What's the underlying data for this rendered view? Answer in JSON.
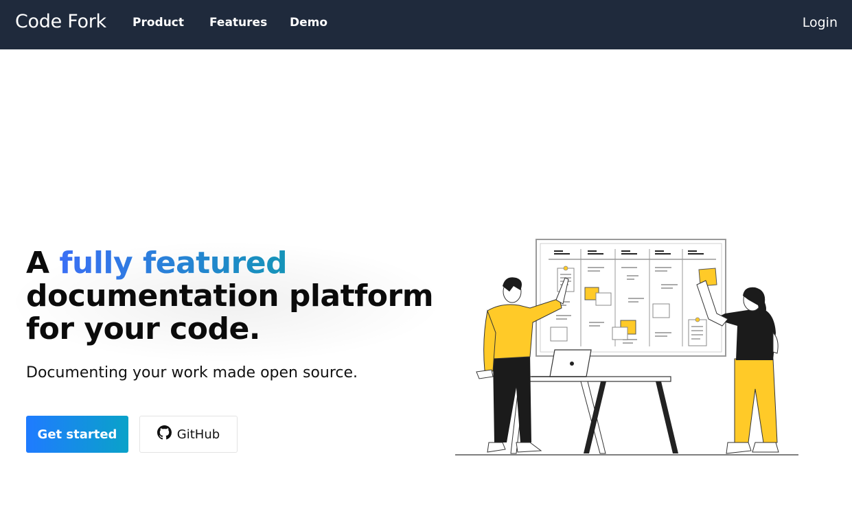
{
  "nav": {
    "brand": "Code Fork",
    "links": [
      "Product",
      "Features",
      "Demo"
    ],
    "login": "Login"
  },
  "hero": {
    "title_prefix": "A ",
    "title_accent": "fully featured",
    "title_line2": "documentation platform",
    "title_line3": "for your code.",
    "subtitle": "Documenting your work made open source."
  },
  "buttons": {
    "primary": "Get started",
    "github": "GitHub"
  },
  "colors": {
    "navbar": "#1f2a3c",
    "accent_start": "#3b6ff5",
    "accent_end": "#1594b8",
    "button_start": "#1f7bff",
    "button_end": "#0aa2c9",
    "illustration_yellow": "#ffca28"
  },
  "icons": {
    "github": "github-icon"
  }
}
